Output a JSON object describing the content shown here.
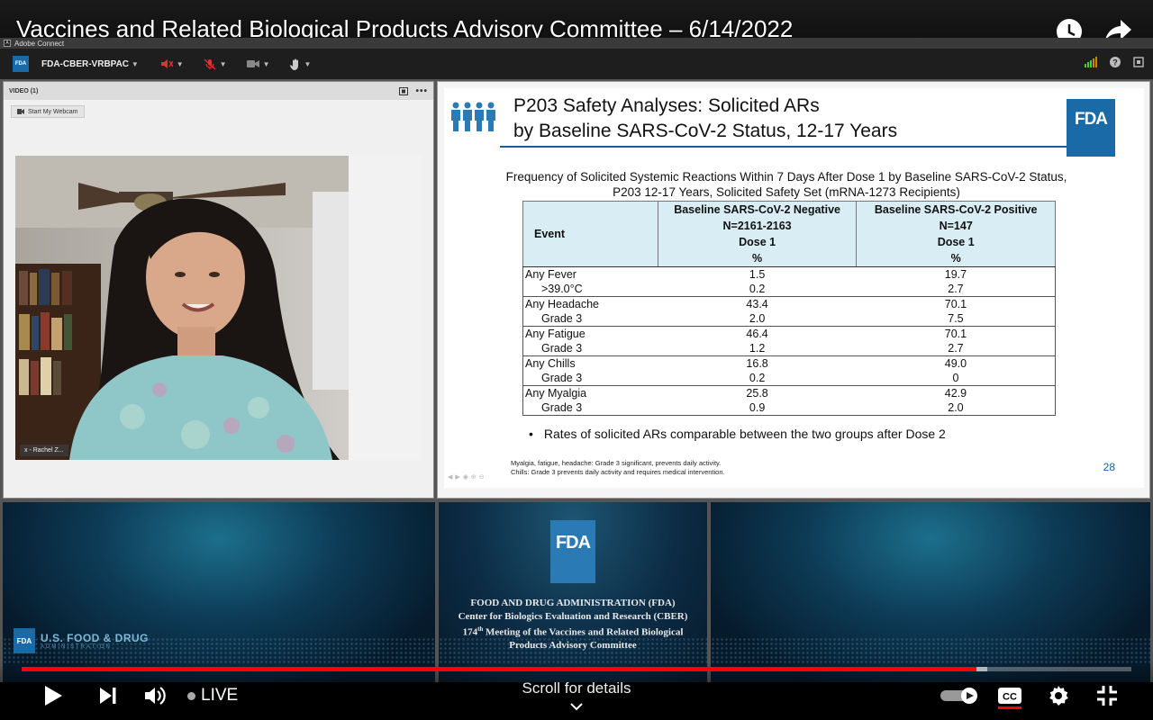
{
  "video": {
    "title": "Vaccines and Related Biological Products Advisory Committee – 6/14/2022"
  },
  "app": {
    "name": "Adobe Connect",
    "logo_text": "FDA",
    "room_name": "FDA-CBER-VRBPAC"
  },
  "video_pod": {
    "header": "VIDEO (1)",
    "webcam_button": "Start My Webcam",
    "participant_name": "x - Rachel Z..."
  },
  "slide": {
    "title_line1": "P203 Safety Analyses: Solicited ARs",
    "title_line2": "by Baseline SARS-CoV-2 Status, 12-17 Years",
    "logo_text": "FDA",
    "subtitle_line1": "Frequency of Solicited Systemic Reactions Within 7 Days After Dose 1 by Baseline SARS-CoV-2 Status,",
    "subtitle_line2": "P203 12-17 Years, Solicited Safety Set (mRNA-1273 Recipients)",
    "table": {
      "col_event": "Event",
      "col_neg": [
        "Baseline SARS-CoV-2 Negative",
        "N=2161-2163",
        "Dose 1",
        "%"
      ],
      "col_pos": [
        "Baseline SARS-CoV-2 Positive",
        "N=147",
        "Dose 1",
        "%"
      ],
      "rows": [
        {
          "event": "Any Fever",
          "neg": "1.5",
          "pos": "19.7"
        },
        {
          "event": ">39.0°C",
          "neg": "0.2",
          "pos": "2.7"
        },
        {
          "event": "Any Headache",
          "neg": "43.4",
          "pos": "70.1"
        },
        {
          "event": "Grade 3",
          "neg": "2.0",
          "pos": "7.5"
        },
        {
          "event": "Any Fatigue",
          "neg": "46.4",
          "pos": "70.1"
        },
        {
          "event": "Grade 3",
          "neg": "1.2",
          "pos": "2.7"
        },
        {
          "event": "Any Chills",
          "neg": "16.8",
          "pos": "49.0"
        },
        {
          "event": "Grade 3",
          "neg": "0.2",
          "pos": "0"
        },
        {
          "event": "Any Myalgia",
          "neg": "25.8",
          "pos": "42.9"
        },
        {
          "event": "Grade 3",
          "neg": "0.9",
          "pos": "2.0"
        }
      ]
    },
    "bullet": "Rates of solicited ARs comparable between the two groups after Dose 2",
    "footnote_line1": "Myalgia, fatigue, headache: Grade 3 significant, prevents daily activity.",
    "footnote_line2": "Chills: Grade 3 prevents daily activity and requires medical intervention.",
    "page_number": "28"
  },
  "branding": {
    "usfda_box": "FDA",
    "usfda_name": "U.S. FOOD & DRUG",
    "usfda_sub": "ADMINISTRATION",
    "center_logo": "FDA",
    "center_line1": "FOOD AND DRUG ADMINISTRATION (FDA)",
    "center_line2": "Center for Biologics Evaluation and Research (CBER)",
    "center_line3_num": "174",
    "center_line3_sup": "th",
    "center_line3_rest": " Meeting of the Vaccines and Related Biological",
    "center_line4": "Products Advisory Committee"
  },
  "player": {
    "live_label": "LIVE",
    "scroll_hint": "Scroll for details",
    "progress_played": 0.86,
    "progress_buffered": 0.87
  },
  "colors": {
    "fda_blue": "#1a6aa8",
    "progress_red": "#ff0000",
    "table_header": "#d9edf5"
  }
}
